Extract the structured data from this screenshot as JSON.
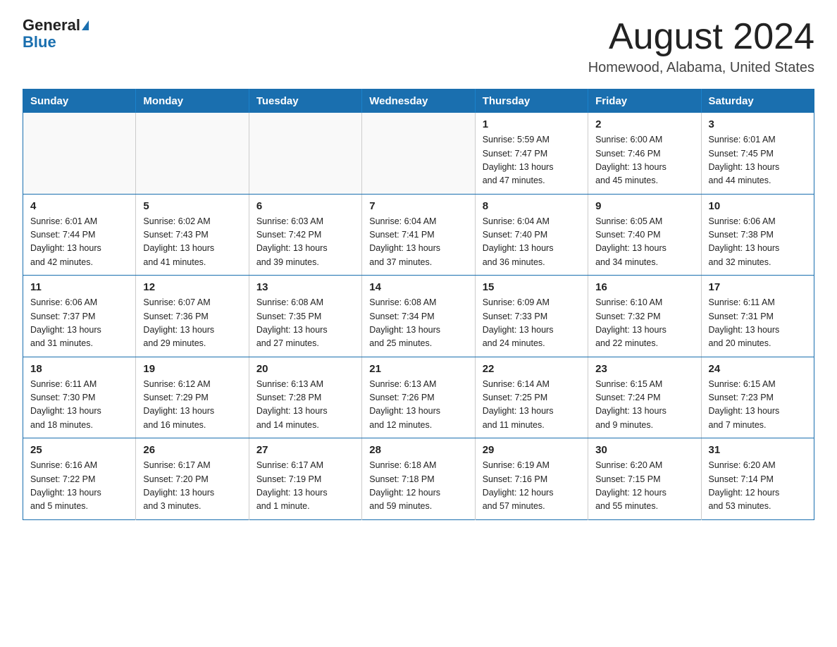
{
  "header": {
    "logo_general": "General",
    "logo_blue": "Blue",
    "title": "August 2024",
    "subtitle": "Homewood, Alabama, United States"
  },
  "days_of_week": [
    "Sunday",
    "Monday",
    "Tuesday",
    "Wednesday",
    "Thursday",
    "Friday",
    "Saturday"
  ],
  "weeks": [
    [
      {
        "day": "",
        "info": ""
      },
      {
        "day": "",
        "info": ""
      },
      {
        "day": "",
        "info": ""
      },
      {
        "day": "",
        "info": ""
      },
      {
        "day": "1",
        "info": "Sunrise: 5:59 AM\nSunset: 7:47 PM\nDaylight: 13 hours\nand 47 minutes."
      },
      {
        "day": "2",
        "info": "Sunrise: 6:00 AM\nSunset: 7:46 PM\nDaylight: 13 hours\nand 45 minutes."
      },
      {
        "day": "3",
        "info": "Sunrise: 6:01 AM\nSunset: 7:45 PM\nDaylight: 13 hours\nand 44 minutes."
      }
    ],
    [
      {
        "day": "4",
        "info": "Sunrise: 6:01 AM\nSunset: 7:44 PM\nDaylight: 13 hours\nand 42 minutes."
      },
      {
        "day": "5",
        "info": "Sunrise: 6:02 AM\nSunset: 7:43 PM\nDaylight: 13 hours\nand 41 minutes."
      },
      {
        "day": "6",
        "info": "Sunrise: 6:03 AM\nSunset: 7:42 PM\nDaylight: 13 hours\nand 39 minutes."
      },
      {
        "day": "7",
        "info": "Sunrise: 6:04 AM\nSunset: 7:41 PM\nDaylight: 13 hours\nand 37 minutes."
      },
      {
        "day": "8",
        "info": "Sunrise: 6:04 AM\nSunset: 7:40 PM\nDaylight: 13 hours\nand 36 minutes."
      },
      {
        "day": "9",
        "info": "Sunrise: 6:05 AM\nSunset: 7:40 PM\nDaylight: 13 hours\nand 34 minutes."
      },
      {
        "day": "10",
        "info": "Sunrise: 6:06 AM\nSunset: 7:38 PM\nDaylight: 13 hours\nand 32 minutes."
      }
    ],
    [
      {
        "day": "11",
        "info": "Sunrise: 6:06 AM\nSunset: 7:37 PM\nDaylight: 13 hours\nand 31 minutes."
      },
      {
        "day": "12",
        "info": "Sunrise: 6:07 AM\nSunset: 7:36 PM\nDaylight: 13 hours\nand 29 minutes."
      },
      {
        "day": "13",
        "info": "Sunrise: 6:08 AM\nSunset: 7:35 PM\nDaylight: 13 hours\nand 27 minutes."
      },
      {
        "day": "14",
        "info": "Sunrise: 6:08 AM\nSunset: 7:34 PM\nDaylight: 13 hours\nand 25 minutes."
      },
      {
        "day": "15",
        "info": "Sunrise: 6:09 AM\nSunset: 7:33 PM\nDaylight: 13 hours\nand 24 minutes."
      },
      {
        "day": "16",
        "info": "Sunrise: 6:10 AM\nSunset: 7:32 PM\nDaylight: 13 hours\nand 22 minutes."
      },
      {
        "day": "17",
        "info": "Sunrise: 6:11 AM\nSunset: 7:31 PM\nDaylight: 13 hours\nand 20 minutes."
      }
    ],
    [
      {
        "day": "18",
        "info": "Sunrise: 6:11 AM\nSunset: 7:30 PM\nDaylight: 13 hours\nand 18 minutes."
      },
      {
        "day": "19",
        "info": "Sunrise: 6:12 AM\nSunset: 7:29 PM\nDaylight: 13 hours\nand 16 minutes."
      },
      {
        "day": "20",
        "info": "Sunrise: 6:13 AM\nSunset: 7:28 PM\nDaylight: 13 hours\nand 14 minutes."
      },
      {
        "day": "21",
        "info": "Sunrise: 6:13 AM\nSunset: 7:26 PM\nDaylight: 13 hours\nand 12 minutes."
      },
      {
        "day": "22",
        "info": "Sunrise: 6:14 AM\nSunset: 7:25 PM\nDaylight: 13 hours\nand 11 minutes."
      },
      {
        "day": "23",
        "info": "Sunrise: 6:15 AM\nSunset: 7:24 PM\nDaylight: 13 hours\nand 9 minutes."
      },
      {
        "day": "24",
        "info": "Sunrise: 6:15 AM\nSunset: 7:23 PM\nDaylight: 13 hours\nand 7 minutes."
      }
    ],
    [
      {
        "day": "25",
        "info": "Sunrise: 6:16 AM\nSunset: 7:22 PM\nDaylight: 13 hours\nand 5 minutes."
      },
      {
        "day": "26",
        "info": "Sunrise: 6:17 AM\nSunset: 7:20 PM\nDaylight: 13 hours\nand 3 minutes."
      },
      {
        "day": "27",
        "info": "Sunrise: 6:17 AM\nSunset: 7:19 PM\nDaylight: 13 hours\nand 1 minute."
      },
      {
        "day": "28",
        "info": "Sunrise: 6:18 AM\nSunset: 7:18 PM\nDaylight: 12 hours\nand 59 minutes."
      },
      {
        "day": "29",
        "info": "Sunrise: 6:19 AM\nSunset: 7:16 PM\nDaylight: 12 hours\nand 57 minutes."
      },
      {
        "day": "30",
        "info": "Sunrise: 6:20 AM\nSunset: 7:15 PM\nDaylight: 12 hours\nand 55 minutes."
      },
      {
        "day": "31",
        "info": "Sunrise: 6:20 AM\nSunset: 7:14 PM\nDaylight: 12 hours\nand 53 minutes."
      }
    ]
  ]
}
